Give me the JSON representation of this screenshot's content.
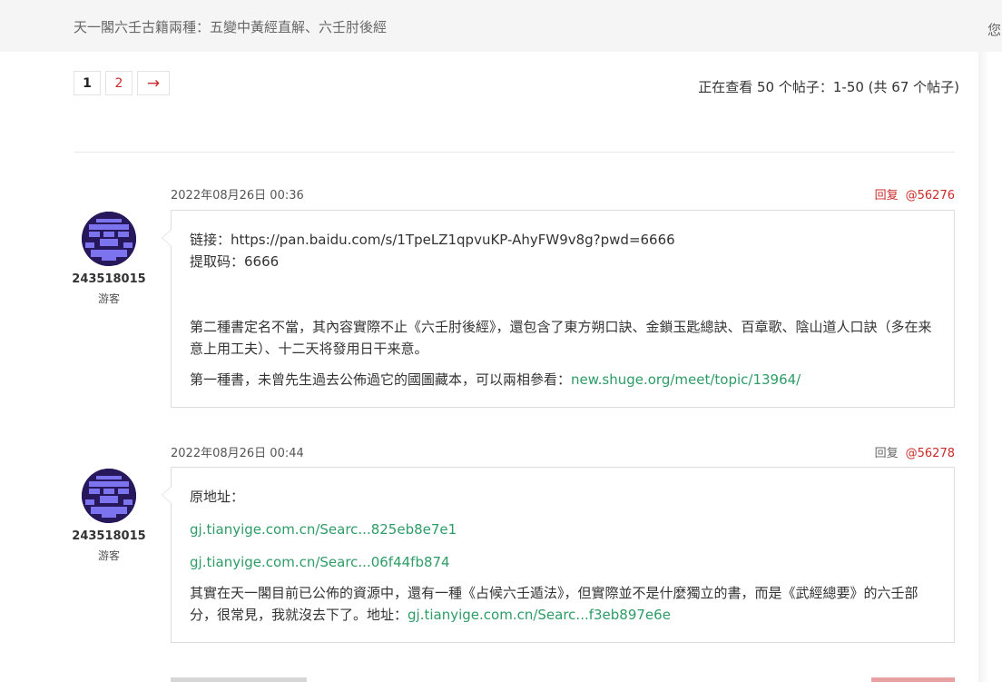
{
  "header": {
    "breadcrumb": "天一閣六壬古籍兩種：五變中黃經直解、六壬肘後經",
    "right_text": "您"
  },
  "pagination": {
    "pages": [
      "1",
      "2"
    ],
    "current": "1",
    "next_label": "→",
    "count_text": "正在查看 50 个帖子：1-50 (共 67 个帖子)"
  },
  "colors": {
    "accent": "#cc2a2a",
    "link": "#2e9c66",
    "avatar_bg": "#27185c",
    "avatar_fg": "#7c74ee"
  },
  "posts": [
    {
      "date": "2022年08月26日 00:36",
      "reply_label": "回复",
      "post_id": "@56276",
      "author": {
        "name": "243518015",
        "role": "游客",
        "avatar_icon": "identicon-avatar"
      },
      "content": {
        "line1": "链接：https://pan.baidu.com/s/1TpeLZ1qpvuKP-AhyFW9v8g?pwd=6666",
        "line2": "提取码：6666",
        "para1": "第二種書定名不當，其內容實際不止《六壬肘後經》，還包含了東方朔口訣、金鎖玉匙總訣、百章歌、陰山道人口訣（多在来意上用工夫）、十二天将發用日干来意。",
        "para2_text": "第一種書，未曾先生過去公佈過它的國圖藏本，可以兩相參看：",
        "para2_link": "new.shuge.org/meet/topic/13964/"
      }
    },
    {
      "date": "2022年08月26日 00:44",
      "reply_label": "回复",
      "post_id": "@56278",
      "author": {
        "name": "243518015",
        "role": "游客",
        "avatar_icon": "identicon-avatar"
      },
      "content": {
        "intro": "原地址：",
        "link1": "gj.tianyige.com.cn/Searc...825eb8e7e1",
        "link2": "gj.tianyige.com.cn/Searc...06f44fb874",
        "para_text": "其實在天一閣目前已公佈的資源中，還有一種《占候六壬遁法》，但實際並不是什麼獨立的書，而是《武經總要》的六壬部分，很常見，我就沒去下了。地址：",
        "para_link": "gj.tianyige.com.cn/Searc...f3eb897e6e"
      }
    }
  ]
}
